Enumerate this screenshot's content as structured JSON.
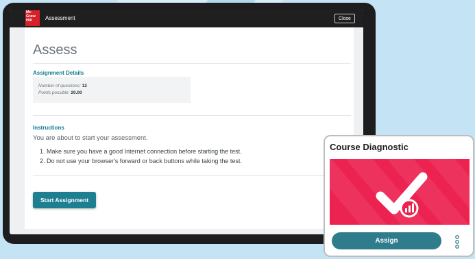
{
  "app": {
    "title": "Assessment",
    "logo_text": "Mc Graw Hill",
    "close_label": "Close"
  },
  "page": {
    "title": "Assess",
    "details": {
      "heading": "Assignment Details",
      "questions_label": "Number of questions:",
      "questions_value": "12",
      "points_label": "Points possible:",
      "points_value": "20.00"
    },
    "instructions": {
      "heading": "Instructions",
      "lead": "You are about to start your assessment.",
      "items": [
        "1. Make sure you have a good Internet connection before starting the test.",
        "2. Do not use your browser's forward or back buttons while taking the test."
      ]
    },
    "start_label": "Start Assignment"
  },
  "card": {
    "title": "Course Diagnostic",
    "assign_label": "Assign",
    "banner_color": "#ec2250",
    "icon": "checkmark-chart-icon"
  },
  "colors": {
    "accent": "#1d7f90",
    "brand_red": "#d6202a",
    "background": "#c4e3f5"
  }
}
